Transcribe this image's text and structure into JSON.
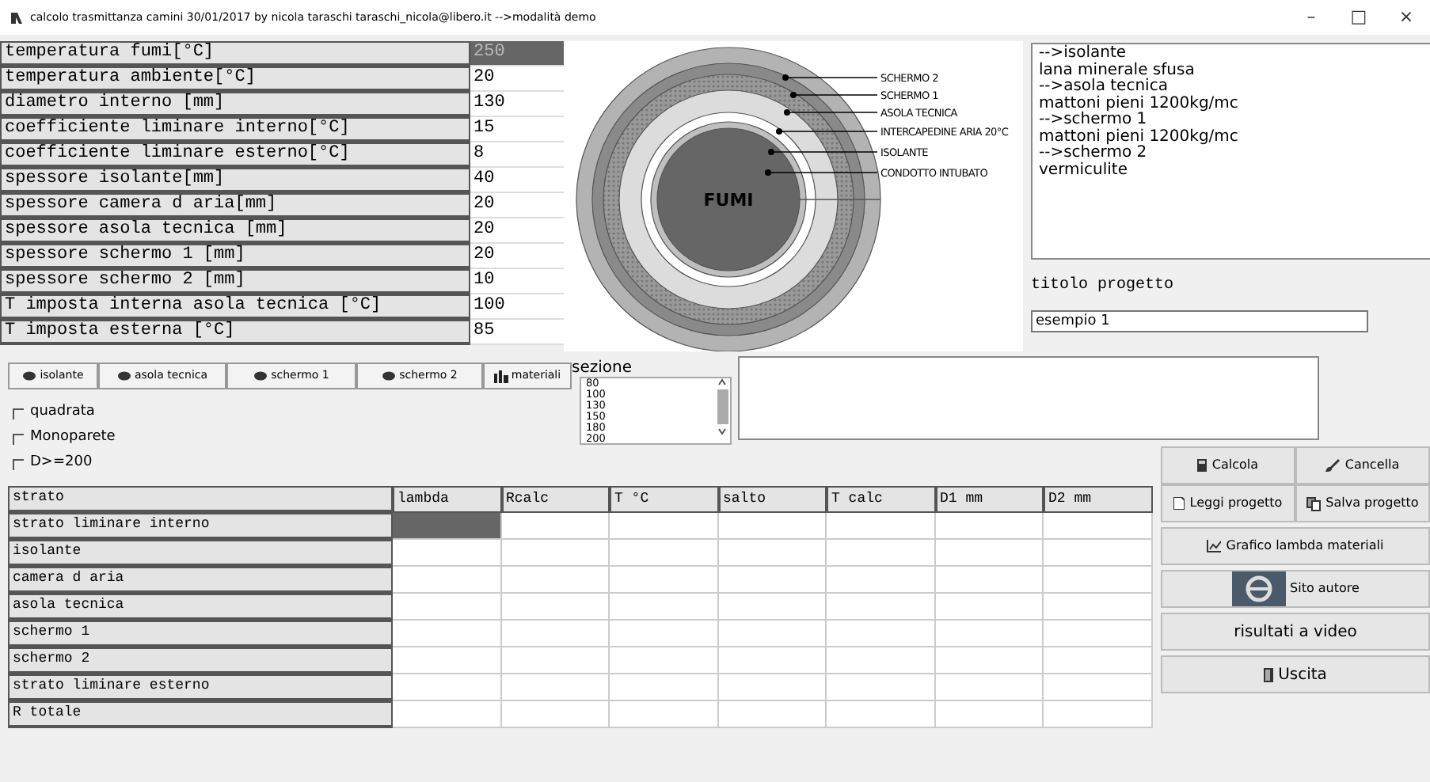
{
  "window": {
    "title": "calcolo trasmittanza camini 30/01/2017  by nicola taraschi taraschi_nicola@libero.it -->modalità demo",
    "controls": [
      "–",
      "□",
      "×"
    ]
  },
  "inputs": [
    {
      "label": "temperatura fumi[°C]",
      "value": "250",
      "selected": true
    },
    {
      "label": "temperatura ambiente[°C]",
      "value": "20",
      "selected": false
    },
    {
      "label": "diametro interno [mm]",
      "value": "130",
      "selected": false
    },
    {
      "label": "coefficiente liminare interno[°C]",
      "value": "15",
      "selected": false
    },
    {
      "label": "coefficiente liminare esterno[°C]",
      "value": "8",
      "selected": false
    },
    {
      "label": "spessore isolante[mm]",
      "value": "40",
      "selected": false
    },
    {
      "label": "spessore camera d aria[mm]",
      "value": "20",
      "selected": false
    },
    {
      "label": "spessore asola tecnica [mm]",
      "value": "20",
      "selected": false
    },
    {
      "label": "spessore schermo 1 [mm]",
      "value": "20",
      "selected": false
    },
    {
      "label": "spessore schermo 2 [mm]",
      "value": "10",
      "selected": false
    },
    {
      "label": "T imposta interna asola tecnica [°C]",
      "value": "100",
      "selected": false
    },
    {
      "label": "T imposta esterna  [°C]",
      "value": "85",
      "selected": false
    }
  ],
  "diagram": {
    "center_label": "FUMI",
    "labels": [
      "SCHERMO 2",
      "SCHERMO 1",
      "ASOLA TECNICA",
      "INTERCAPEDINE ARIA 20°C",
      "ISOLANTE",
      "CONDOTTO INTUBATO"
    ]
  },
  "materials_text": [
    "-->isolante",
    "lana minerale sfusa",
    "-->asola tecnica",
    "mattoni pieni 1200kg/mc",
    "-->schermo 1",
    "mattoni pieni 1200kg/mc",
    "-->schermo 2",
    "vermiculite"
  ],
  "project_title": {
    "label": "titolo progetto",
    "value": "esempio 1"
  },
  "toolbar": [
    {
      "label": "isolante",
      "kind": "disk"
    },
    {
      "label": "asola tecnica",
      "kind": "disk"
    },
    {
      "label": "schermo 1",
      "kind": "disk"
    },
    {
      "label": "schermo 2",
      "kind": "disk"
    },
    {
      "label": "materiali",
      "kind": "books"
    }
  ],
  "options": [
    {
      "label": "quadrata",
      "checked": false
    },
    {
      "label": "Monoparete",
      "checked": false
    },
    {
      "label": "D>=200",
      "checked": false
    }
  ],
  "section": {
    "label": "sezione",
    "items": [
      "80",
      "100",
      "130",
      "150",
      "180",
      "200"
    ]
  },
  "table": {
    "columns": [
      "strato",
      "lambda",
      "Rcalc",
      "T °C",
      "salto",
      "T calc",
      "D1 mm",
      "D2 mm"
    ],
    "rows": [
      {
        "label": "strato liminare interno",
        "selected": true
      },
      {
        "label": "isolante",
        "selected": false
      },
      {
        "label": "camera d aria",
        "selected": false
      },
      {
        "label": "asola tecnica",
        "selected": false
      },
      {
        "label": "schermo 1",
        "selected": false
      },
      {
        "label": "schermo 2",
        "selected": false
      },
      {
        "label": "strato liminare esterno",
        "selected": false
      },
      {
        "label": "R totale",
        "selected": false
      }
    ]
  },
  "button_rows": [
    [
      {
        "label": "Calcola",
        "kind": "calculator"
      },
      {
        "label": "Cancella",
        "kind": "brush"
      }
    ],
    [
      {
        "label": "Leggi progetto",
        "kind": "document"
      },
      {
        "label": "Salva progetto",
        "kind": "copy"
      }
    ],
    [
      {
        "label": "Grafico lambda materiali",
        "kind": "chart"
      }
    ],
    [
      {
        "label": "Sito autore",
        "kind": "browser"
      }
    ],
    [
      {
        "label": "risultati a video",
        "kind": "none"
      }
    ],
    [
      {
        "label": "Uscita",
        "kind": "door"
      }
    ]
  ]
}
